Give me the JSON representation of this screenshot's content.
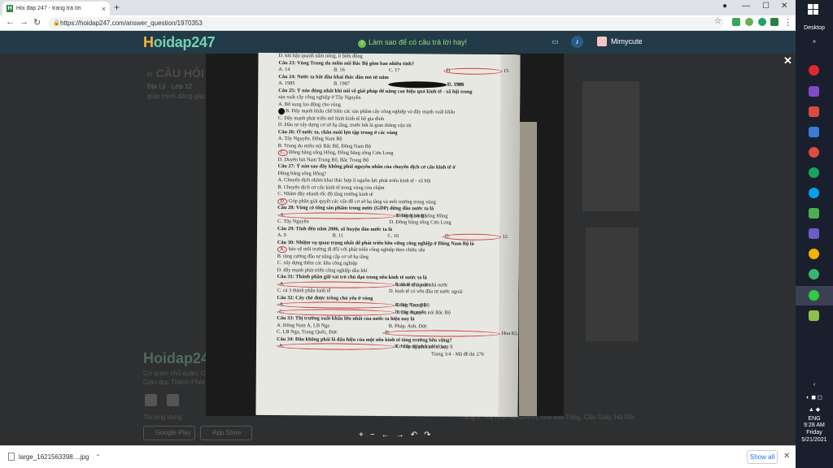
{
  "browser": {
    "tab_title": "Hỏi đáp 247 - trang trả lời",
    "url": "https://hoidap247.com/answer_question/1970353",
    "colors": {
      "tabbar": "#dee1e6",
      "site_header": "#233a48"
    }
  },
  "site": {
    "logo": "Hoidap247",
    "banner": "Làm sao để có câu trả lời hay!",
    "username": "Mimycute",
    "bg_title": "« CÂU HỎI",
    "bg_subject": "Địa Lý · Lớp 12",
    "bg_sub": "giúp mình đáng gấp",
    "bg_footer_lines": [
      "Cơ quan chủ quản: Cô",
      "Giáo dục Thành Phát"
    ],
    "bg_download_label": "Tải ứng dụng",
    "store_google": "Google Play",
    "store_apple": "App Store",
    "footer_address": "Tầng 2, tòa nhà Hồ Gươm, nhà mái Tống, Cầu Giấy, Hà Nội."
  },
  "paper": {
    "lines": [
      {
        "t": "D. khí hậu quanh năm nóng, ít biến động"
      },
      {
        "t": "Câu 23: Vùng Trung du miền núi Bắc Bộ gồm bao nhiêu tỉnh?",
        "q": true
      },
      {
        "four": [
          "A. 14",
          "B. 16",
          "C. 17",
          "D. 15"
        ]
      },
      {
        "t": "Câu 24: Nước ta bắt đầu khai thác dầu mỏ từ năm",
        "q": true
      },
      {
        "four": [
          "A. 1985",
          "B. 1987",
          "C. 1986",
          "D. 1989"
        ]
      },
      {
        "t": "Câu 25: Ý nào đúng nhất khi nói về giải pháp để nâng cao hiệu quả kinh tế - xã hội trong",
        "q": true
      },
      {
        "t": "sản xuất cây công nghiệp ở Tây Nguyên"
      },
      {
        "t": "A. Bổ sung lao động cho vùng"
      },
      {
        "t": "B. Đẩy mạnh khâu chế biến các sản phẩm cây công nghiệp và đẩy mạnh xuất khẩu"
      },
      {
        "t": "C. Đẩy mạnh phát triển mô hình kinh tế hộ gia đình"
      },
      {
        "t": "D. Đầu tư xây dựng cơ sở hạ tầng, trước hết là giao thông vận tải"
      },
      {
        "t": "Câu 26: Ở nước ta, chăn nuôi lợn tập trung ở các vùng",
        "q": true
      },
      {
        "t": "A. Tây Nguyên, Đông Nam Bộ"
      },
      {
        "t": "B. Trung du miền núi Bắc Bộ, Đông Nam Bộ"
      },
      {
        "t": "C. Đồng bằng sông Hồng, Đồng bằng sông Cửu Long"
      },
      {
        "t": "D. Duyên hải Nam Trung Bộ, Bắc Trung Bộ"
      },
      {
        "t": "Câu 27: Ý nào sau đây không phải nguyên nhân của chuyển dịch cơ cấu kinh tế ở",
        "q": true
      },
      {
        "t": "Đồng bằng sông Hồng?"
      },
      {
        "t": "A. Chuyển dịch nhằm khai thác hợp lí nguồn lực phát triển kinh tế - xã hội"
      },
      {
        "t": "B. Chuyển dịch cơ cấu kinh tế trong vùng còn chậm"
      },
      {
        "t": "C. Nhằm đẩy nhanh tốc độ tăng trưởng kinh tế"
      },
      {
        "t": "D. Góp phần giải quyết các vấn đề cơ sở hạ tầng và môi trường trong vùng"
      },
      {
        "t": "Câu 28: Vùng có tổng sản phẩm trong nước (GDP) đứng đầu nước ta là",
        "q": true
      },
      {
        "two": [
          "A. Đông Nam Bộ",
          "B. Đồng bằng sông Hồng"
        ]
      },
      {
        "two": [
          "C. Tây Nguyên",
          "D. Đồng bằng sông Cửu Long"
        ]
      },
      {
        "t": "Câu 29: Tính đến năm 2006, số huyện đảo nước ta là",
        "q": true
      },
      {
        "four": [
          "A. 9",
          "B. 11",
          "C. 10",
          "D. 12"
        ]
      },
      {
        "t": "Câu 30: Nhiệm vụ quan trọng nhất để phát triển bền vững công nghiệp ở Đông Nam Bộ là",
        "q": true
      },
      {
        "t": "A. bảo vệ môi trường đi đôi với phát triển công nghiệp theo chiều sâu"
      },
      {
        "t": "B. tăng cường đầu tư nâng cấp cơ sở hạ tầng"
      },
      {
        "t": "C. xây dựng thêm các khu công nghiệp"
      },
      {
        "t": "D. đẩy mạnh phát triển công nghiệp dầu khí"
      },
      {
        "t": "Câu 31: Thành phần giữ vai trò chủ đạo trong nền kinh tế nước ta là",
        "q": true
      },
      {
        "two": [
          "A. kinh tế nhà nước",
          "B. kinh tế ngoài nhà nước"
        ]
      },
      {
        "two": [
          "C. cả 3 thành phần kinh tế",
          "D. kinh tế có vốn đầu tư nước ngoài"
        ]
      },
      {
        "t": "Câu 32: Cây chè được trồng chủ yếu ở vùng",
        "q": true
      },
      {
        "two": [
          "A. Đông Nam Bộ",
          "B. Bắc Trung Bộ"
        ]
      },
      {
        "two": [
          "C. Trung du miền núi Bắc Bộ",
          "D. Tây Nguyên"
        ]
      },
      {
        "t": "Câu 33: Thị trường xuất khẩu lớn nhất của nước ta hiện nay là",
        "q": true
      },
      {
        "two": [
          "A. Đông Nam Á, LB Nga",
          "B. Pháp, Anh, Đức"
        ]
      },
      {
        "two": [
          "C. LB Nga, Trung Quốc, Đức",
          "D. Hoa Kì, Nhật Bản, Trung Quốc"
        ]
      },
      {
        "t": "Câu 34: Đâu không phải là dấu hiệu của một nền kinh tế tăng trưởng bền vững?",
        "q": true
      },
      {
        "two": [
          "A. Cơ cấu ngành kinh tế hợp lí",
          "B. Nhịp độ phát triển cao"
        ]
      },
      {
        "t": "Trang 3/4 - Mã đề thi 276",
        "right": true
      }
    ]
  },
  "viewer_tools": [
    "+",
    "−",
    "←",
    "→",
    "↶",
    "↷"
  ],
  "close_label": "✕",
  "downloads": {
    "file": "large_1621563398....jpg",
    "show_all": "Show all"
  },
  "taskbar": {
    "desktop": "Desktop",
    "lang": "ENG",
    "time": "9:28 AM",
    "day": "Friday",
    "date": "5/21/2021"
  }
}
